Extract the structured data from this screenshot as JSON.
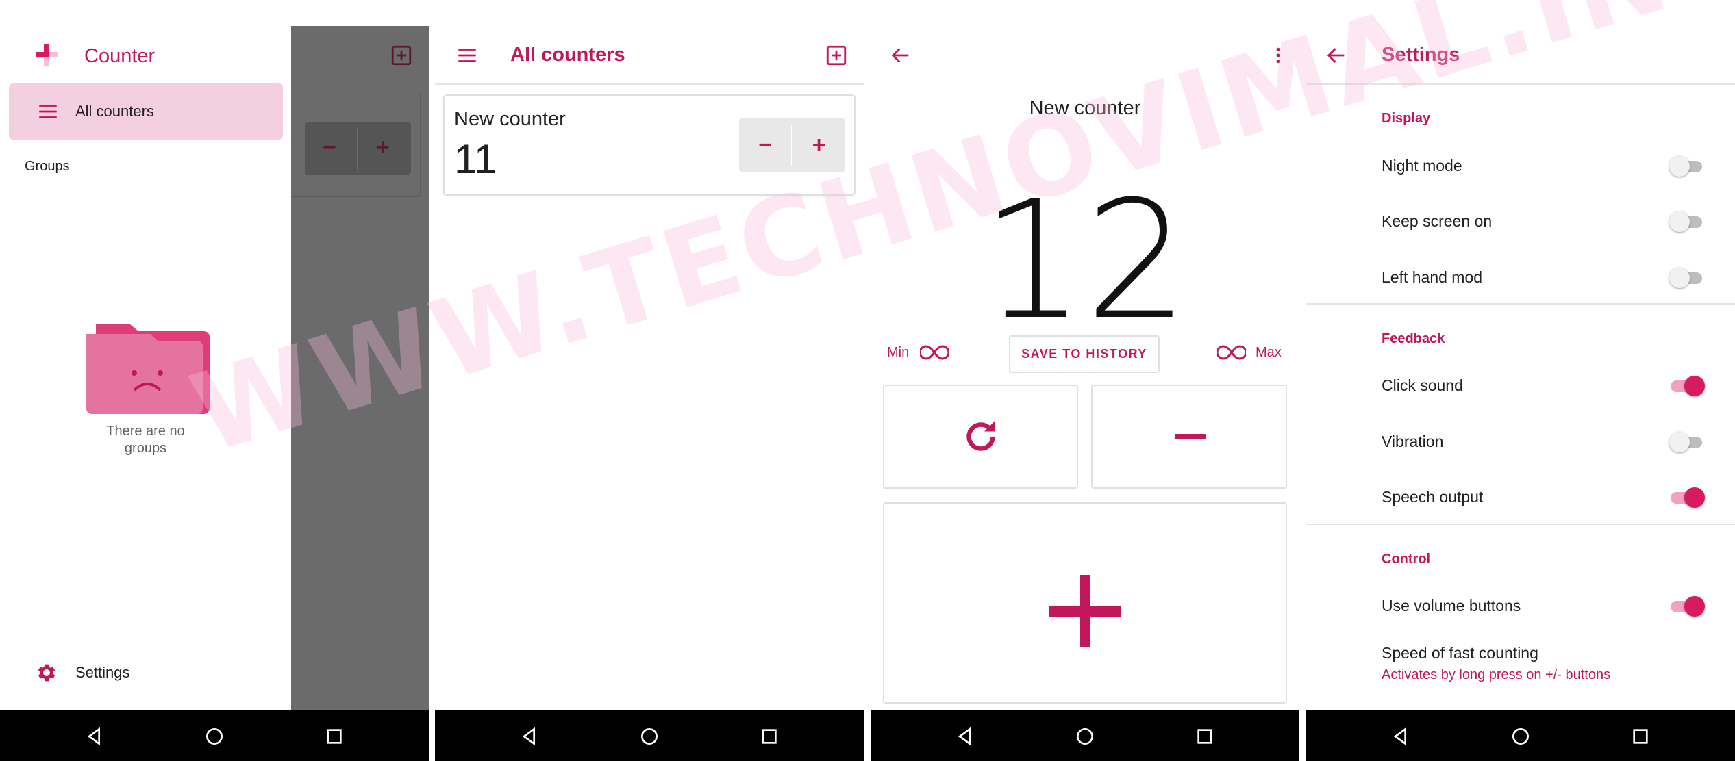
{
  "drawer_screen": {
    "app_name": "Counter",
    "menu": {
      "all_counters_label": "All counters",
      "groups_heading": "Groups"
    },
    "empty_state": {
      "line1": "There are no",
      "line2": "groups"
    },
    "settings_label": "Settings",
    "behind_minus": "−",
    "behind_plus": "+"
  },
  "list_screen": {
    "title": "All counters",
    "counter": {
      "name": "New counter",
      "value": "11",
      "minus": "−",
      "plus": "+"
    }
  },
  "counter_screen": {
    "name": "New counter",
    "value": "12",
    "min_label": "Min",
    "max_label": "Max",
    "save_label": "SAVE TO HISTORY",
    "minus": "−",
    "plus": "+"
  },
  "settings_screen": {
    "title": "Settings",
    "display_section": "Display",
    "night_mode": "Night mode",
    "keep_screen_on": "Keep screen on",
    "left_hand_mod": "Left hand mod",
    "feedback_section": "Feedback",
    "click_sound": "Click sound",
    "vibration": "Vibration",
    "speech_output": "Speech output",
    "control_section": "Control",
    "use_volume_buttons": "Use volume buttons",
    "fast_counting_title": "Speed of fast counting",
    "fast_counting_subtitle": "Activates by long press on +/- buttons",
    "toggles": {
      "night_mode": false,
      "keep_screen_on": false,
      "left_hand_mod": false,
      "click_sound": true,
      "vibration": false,
      "speech_output": true,
      "use_volume_buttons": true
    }
  },
  "watermark": "WWW.TECHNOVIMAL.IN",
  "colors": {
    "accent": "#c2185b",
    "accent_light": "#f3cfe0",
    "navbar": "#000000",
    "scrim": "#6b6b6b"
  },
  "icons": {
    "menu": "hamburger-icon",
    "add": "add-box-icon",
    "back": "arrow-back-icon",
    "more": "more-vert-icon",
    "reset": "refresh-icon",
    "infinity": "infinity-icon",
    "settings": "gear-icon",
    "empty": "sad-folder-icon"
  }
}
